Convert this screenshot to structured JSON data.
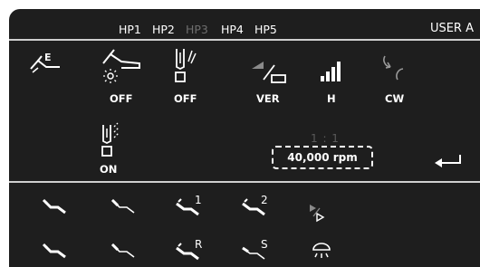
{
  "header": {
    "hp_tabs": [
      {
        "label": "HP1",
        "state": "normal"
      },
      {
        "label": "HP2",
        "state": "normal"
      },
      {
        "label": "HP3",
        "state": "disabled"
      },
      {
        "label": "HP4",
        "state": "normal"
      },
      {
        "label": "HP5",
        "state": "normal"
      }
    ],
    "user": "USER A"
  },
  "settings": {
    "light": {
      "icon": "handpiece-light-icon",
      "value": "OFF"
    },
    "spray": {
      "icon": "spray-icon",
      "value": "OFF"
    },
    "mode": {
      "icon": "mode-ver-icon",
      "value": "VER"
    },
    "torque": {
      "icon": "torque-bars-icon",
      "value": "H"
    },
    "direction": {
      "icon": "rotation-direction-icon",
      "value": "CW"
    },
    "coolant": {
      "icon": "coolant-spray-icon",
      "value": "ON"
    },
    "edit": {
      "icon": "handpiece-edit-icon",
      "label": "E"
    }
  },
  "speed": {
    "ratio": "1 : 1",
    "rpm": "40,000 rpm"
  },
  "presets": {
    "row1": [
      {
        "icon": "preset-handpiece-1-icon",
        "label": ""
      },
      {
        "icon": "preset-handpiece-2-icon",
        "label": ""
      },
      {
        "icon": "preset-handpiece-memory1-icon",
        "label": "1"
      },
      {
        "icon": "preset-handpiece-memory2-icon",
        "label": "2"
      },
      {
        "icon": "play-pause-icon",
        "label": ""
      }
    ],
    "row2": [
      {
        "icon": "preset-handpiece-3-icon",
        "label": ""
      },
      {
        "icon": "preset-handpiece-4-icon",
        "label": ""
      },
      {
        "icon": "preset-handpiece-reverse-icon",
        "label": "R"
      },
      {
        "icon": "preset-handpiece-spray-icon",
        "label": "S"
      },
      {
        "icon": "lamp-icon",
        "label": ""
      }
    ]
  },
  "colors": {
    "background": "#1e1e1e",
    "text": "#ffffff",
    "disabled": "#6e6e6e",
    "divider": "#cfcfcf"
  }
}
